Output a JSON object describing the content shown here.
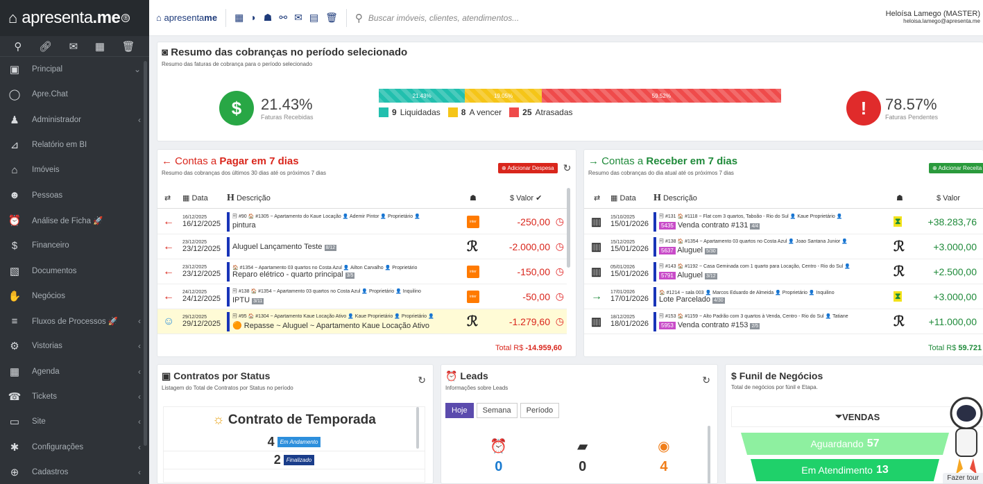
{
  "brand": {
    "name_light": "apresenta",
    "name_bold": ".me",
    "reg": "®"
  },
  "sidebar": {
    "items": [
      {
        "label": "Principal",
        "icon": "dashboard-icon"
      },
      {
        "label": "Apre.Chat",
        "icon": "whatsapp-icon"
      },
      {
        "label": "Administrador",
        "icon": "admin-icon"
      },
      {
        "label": "Relatório em BI",
        "icon": "chart-icon"
      },
      {
        "label": "Imóveis",
        "icon": "home-icon"
      },
      {
        "label": "Pessoas",
        "icon": "people-icon"
      },
      {
        "label": "Análise de Ficha 🚀",
        "icon": "alarm-icon"
      },
      {
        "label": "Financeiro",
        "icon": "dollar-icon"
      },
      {
        "label": "Documentos",
        "icon": "document-icon"
      },
      {
        "label": "Negócios",
        "icon": "handshake-icon"
      },
      {
        "label": "Fluxos de Processos 🚀",
        "icon": "filter-icon"
      },
      {
        "label": "Vistorias",
        "icon": "inspection-icon"
      },
      {
        "label": "Agenda",
        "icon": "calendar-icon"
      },
      {
        "label": "Tickets",
        "icon": "headset-icon"
      },
      {
        "label": "Site",
        "icon": "site-icon"
      },
      {
        "label": "Configurações",
        "icon": "gear-icon"
      },
      {
        "label": "Cadastros",
        "icon": "plus-icon"
      }
    ]
  },
  "topbar": {
    "logo_light": "apresenta",
    "logo_bold": "me",
    "search_placeholder": "Buscar imóveis, clientes, atendimentos...",
    "user_name": "Heloísa Lamego (MASTER)",
    "user_email": "heloisa.lamego@apresenta.me"
  },
  "resumo": {
    "title": "Resumo das cobranças no período selecionado",
    "subtitle": "Resumo das faturas de cobrança para o período selecionado",
    "received_pct": "21.43%",
    "received_label": "Faturas Recebidas",
    "pending_pct": "78.57%",
    "pending_label": "Faturas Pendentes",
    "bar": [
      {
        "label": "21.43%",
        "value": 21.43,
        "color": "#22bfae"
      },
      {
        "label": "19.05%",
        "value": 19.05,
        "color": "#f5c518"
      },
      {
        "label": "59.52%",
        "value": 59.52,
        "color": "#ef4b4b"
      }
    ],
    "legend": [
      {
        "count": "9",
        "label": "Liquidadas",
        "color": "#22bfae"
      },
      {
        "count": "8",
        "label": "A vencer",
        "color": "#f5c518"
      },
      {
        "count": "25",
        "label": "Atrasadas",
        "color": "#ef4b4b"
      }
    ]
  },
  "pagar": {
    "title_pre": "← Contas a ",
    "title_bold": "Pagar",
    "title_post": " em 7 dias",
    "subtitle": "Resumo das cobranças dos últimos 30 dias até os próximos 7 dias",
    "add": "Adicionar Despesa",
    "h_data": "Data",
    "h_desc": "Descrição",
    "h_valor": "$ Valor",
    "total_label": "Total R$ ",
    "total": "-14.959,60",
    "rows": [
      {
        "d1": "16/12/2025",
        "d2": "16/12/2025",
        "l1": "🗐 #90  🏠 #1305 ~ Apartamento do Kaue Locação  👤 Ademir Pintor  👤 Proprietário  👤",
        "l2": "pintura",
        "badge": "",
        "pay": "inter",
        "val": "-250,00"
      },
      {
        "d1": "23/12/2025",
        "d2": "23/12/2025",
        "l1": "",
        "l2": "Aluguel Lançamento Teste",
        "badge": "8/12",
        "pay": "pix",
        "val": "-2.000,00"
      },
      {
        "d1": "23/12/2025",
        "d2": "23/12/2025",
        "l1": "🏠 #1354 ~ Apartamento 03 quartos no Costa Azul  👤 Ailton Carvalho  👤 Proprietário",
        "l2": "Reparo elétrico - quarto principal",
        "badge": "3/5",
        "pay": "inter",
        "val": "-150,00"
      },
      {
        "d1": "24/12/2025",
        "d2": "24/12/2025",
        "l1": "🗐 #138  🏠 #1354 ~ Apartamento 03 quartos no Costa Azul  👤 Proprietário  👤 Inquilino",
        "l2": "IPTU",
        "badge": "3/11",
        "pay": "inter",
        "val": "-50,00"
      },
      {
        "d1": "29/12/2025",
        "d2": "29/12/2025",
        "l1": "🗐 #95  🏠 #1304 ~ Apartamento Kaue Locação Ativo  👤 Kaue Proprietário  👤 Proprietário  👤",
        "l2": "🟠 Repasse ~ Aluguel ~ Apartamento Kaue Locação Ativo",
        "badge": "",
        "pay": "pix",
        "val": "-1.279,60"
      }
    ]
  },
  "receber": {
    "title_pre": "→ Contas a ",
    "title_bold": "Receber",
    "title_post": " em 7 dias",
    "subtitle": "Resumo das cobranças do dia atual até os próximos 7 dias",
    "add": "Adicionar Receita",
    "h_data": "Data",
    "h_desc": "Descrição",
    "h_valor": "$ Valor",
    "total_label": "Total R$ ",
    "total": "59.721",
    "rows": [
      {
        "d1": "15/10/2025",
        "d2": "15/01/2026",
        "l1": "🗐 #131  🏠 #1118 ~ Flat com 3 quartos, Taboão - Rio do Sul  👤 Kaue Proprietário  👤",
        "badge_p": "5435",
        "l2": "Venda contrato #131",
        "badge": "4/4",
        "pay": "boleto",
        "val": "+38.283,76"
      },
      {
        "d1": "15/12/2025",
        "d2": "15/01/2026",
        "l1": "🗐 #138  🏠 #1354 ~ Apartamento 03 quartos no Costa Azul  👤 Joao Santana Junior  👤",
        "badge_p": "5637",
        "l2": "Aluguel",
        "badge": "5/30",
        "pay": "pix",
        "val": "+3.000,00"
      },
      {
        "d1": "05/01/2026",
        "d2": "15/01/2026",
        "l1": "🗐 #143  🏠 #1192 ~ Casa Geminada com 1 quarto para Locação, Centro - Rio do Sul  👤",
        "badge_p": "5791",
        "l2": "Aluguel",
        "badge": "3/12",
        "pay": "pix",
        "val": "+2.500,00"
      },
      {
        "d1": "17/01/2026",
        "d2": "17/01/2026",
        "l1": "🏠 #1214 ~ sala 003  👤 Marcos Eduardo de Almeida  👤 Proprietário  👤 Inquilino",
        "badge_p": "",
        "l2": "Lote Parcelado",
        "badge": "4/30",
        "pay": "boleto",
        "val": "+3.000,00"
      },
      {
        "d1": "18/12/2025",
        "d2": "18/01/2026",
        "l1": "🗐 #153  🏠 #1159 ~ Alto Padrão com 3 quartos à Venda, Centro - Rio do Sul  👤 Tatiane",
        "badge_p": "5953",
        "l2": "Venda contrato #153",
        "badge": "2/5",
        "pay": "pix",
        "val": "+11.000,00"
      }
    ]
  },
  "contratos": {
    "title": "Contratos por Status",
    "subtitle": "Listagem do Total de Contratos por Status no período",
    "heading": "Contrato de Temporada",
    "items": [
      {
        "n": "4",
        "label": "Em Andamento",
        "color": "#2d8fdc"
      },
      {
        "n": "2",
        "label": "Finalizado",
        "color": "#1a3d8a"
      }
    ]
  },
  "leads": {
    "title": "Leads",
    "subtitle": "Informações sobre Leads",
    "tabs": [
      "Hoje",
      "Semana",
      "Período"
    ],
    "counts": [
      {
        "v": "0",
        "color": "#1a7bd0",
        "icon": "alarm-icon"
      },
      {
        "v": "0",
        "color": "#333",
        "icon": "folder-icon"
      },
      {
        "v": "4",
        "color": "#f07e1a",
        "icon": "eye-icon"
      }
    ]
  },
  "funil": {
    "title": "Funil de Negócios",
    "subtitle": "Total de negócios por fúnil e Etapa.",
    "heading": "VENDAS",
    "stages": [
      {
        "label": "Aguardando",
        "count": "57",
        "color": "#8ef0a0"
      },
      {
        "label": "Em Atendimento",
        "count": "13",
        "color": "#1fd16a"
      }
    ],
    "help": "Fazer tour"
  }
}
